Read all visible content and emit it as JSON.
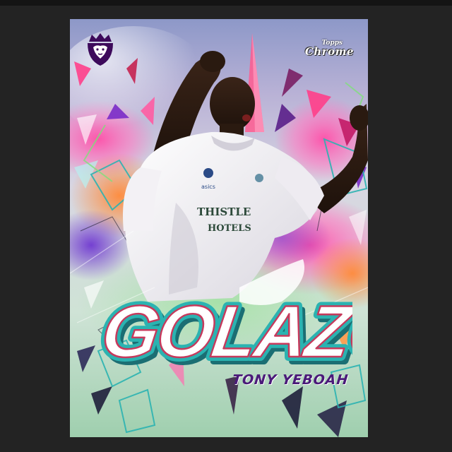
{
  "card": {
    "league_logo": "premier-league-lion-icon",
    "brand": {
      "top": "Topps",
      "name": "Chrome"
    },
    "title": "GOLAZO",
    "player_name": "TONY YEBOAH",
    "shirt_text": "THISTLE HOTELS"
  },
  "colors": {
    "page_background": "#232323",
    "title_fill": "#ffffff",
    "title_outline": "#1f9ea0",
    "name_color": "#4a1a79",
    "accent_teal": "#2bb3b1"
  }
}
